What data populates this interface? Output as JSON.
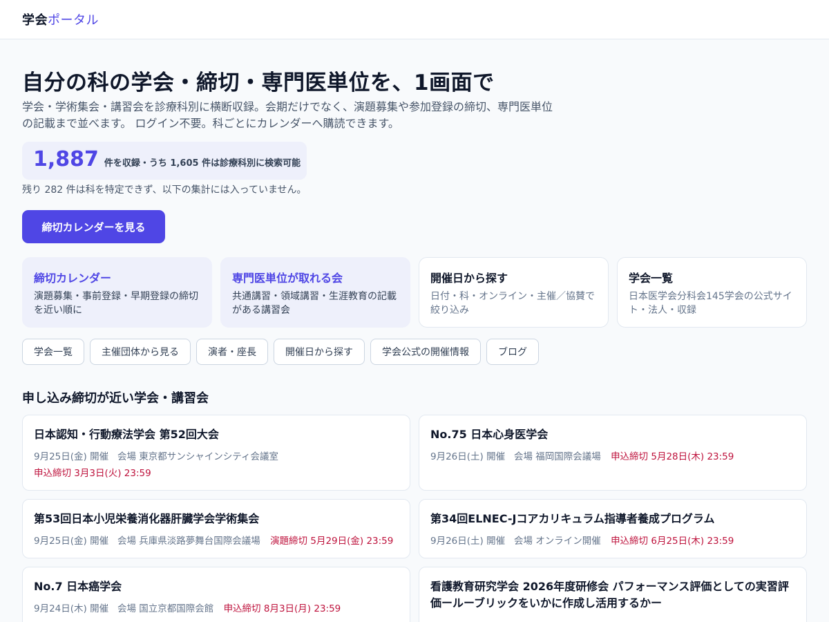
{
  "header": {
    "logo_main": "学会",
    "logo_accent": "ポータル"
  },
  "hero": {
    "title": "自分の科の学会・締切・専門医単位を、1画面で",
    "description": "学会・学術集会・講習会を診療科別に横断収録。会期だけでなく、演題募集や参加登録の締切、専門医単位の記載まで並べます。 ログイン不要。科ごとにカレンダーへ購読できます。"
  },
  "stats": {
    "total": "1,887",
    "summary": "件を収録・うち 1,605 件は診療科別に検索可能",
    "note": "残り 282 件は科を特定できず、以下の集計には入っていません。"
  },
  "cta": {
    "label": "締切カレンダーを見る"
  },
  "cards": [
    {
      "title": "締切カレンダー",
      "desc": "演題募集・事前登録・早期登録の締切を近い順に"
    },
    {
      "title": "専門医単位が取れる会",
      "desc": "共通講習・領域講習・生涯教育の記載がある講習会"
    },
    {
      "title": "開催日から探す",
      "desc": "日付・科・オンライン・主催／協賛で絞り込み"
    },
    {
      "title": "学会一覧",
      "desc": "日本医学会分科会145学会の公式サイト・法人・収録"
    }
  ],
  "pills": [
    "学会一覧",
    "主催団体から見る",
    "演者・座長",
    "開催日から探す",
    "学会公式の開催情報",
    "ブログ"
  ],
  "section": {
    "title": "申し込み締切が近い学会・講習会"
  },
  "events": [
    {
      "title": "日本認知・行動療法学会 第52回大会",
      "date": "9月25日(金) 開催",
      "venue": "会場 東京都サンシャインシティ会議室",
      "deadline": "申込締切 3月3日(火) 23:59"
    },
    {
      "title": "No.75 日本心身医学会",
      "date": "9月26日(土) 開催",
      "venue": "会場 福岡国際会議場",
      "deadline": "申込締切 5月28日(木) 23:59"
    },
    {
      "title": "第53回日本小児栄養消化器肝臓学会学術集会",
      "date": "9月25日(金) 開催",
      "venue": "会場 兵庫県淡路夢舞台国際会議場",
      "deadline": "演題締切 5月29日(金) 23:59"
    },
    {
      "title": "第34回ELNEC-Jコアカリキュラム指導者養成プログラム",
      "date": "9月26日(土) 開催",
      "venue": "会場 オンライン開催",
      "deadline": "申込締切 6月25日(木) 23:59"
    },
    {
      "title": "No.7 日本癌学会",
      "date": "9月24日(木) 開催",
      "venue": "会場 国立京都国際会館",
      "deadline": "申込締切 8月3日(月) 23:59"
    },
    {
      "title": "看護教育研究学会 2026年度研修会 パフォーマンス評価としての実習評価ールーブリックをいかに作成し活用するかー",
      "date": "",
      "venue": "",
      "deadline": ""
    }
  ]
}
